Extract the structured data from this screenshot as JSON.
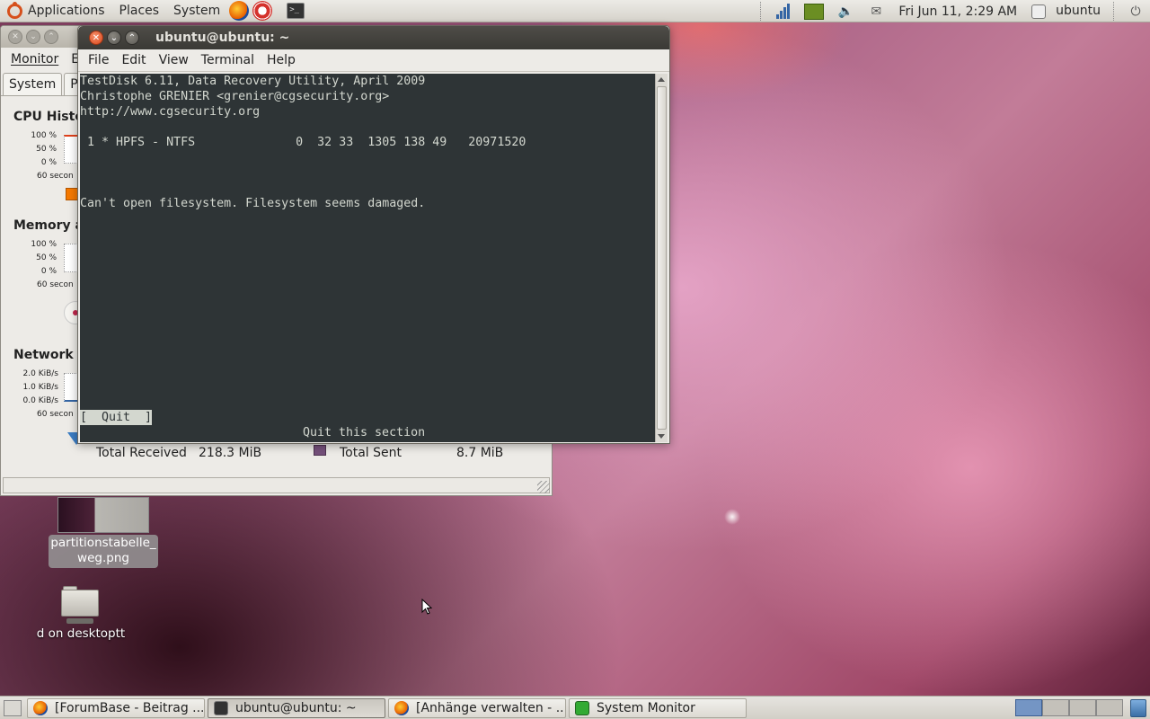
{
  "top_panel": {
    "menus": [
      "Applications",
      "Places",
      "System"
    ],
    "clock": "Fri Jun 11,  2:29 AM",
    "user": "ubuntu"
  },
  "system_monitor": {
    "menus": [
      "Monitor",
      "Ed"
    ],
    "tabs": [
      "System",
      "Pro"
    ],
    "sections": {
      "cpu": "CPU Histo",
      "memory": "Memory a",
      "network": "Network I"
    },
    "cpu_axis": [
      "100 %",
      "50 %",
      "0 %",
      "60 secon"
    ],
    "mem_axis": [
      "100 %",
      "50 %",
      "0 %",
      "60 secon"
    ],
    "net_axis": [
      "2.0 KiB/s",
      "1.0 KiB/s",
      "0.0 KiB/s",
      "60 secon"
    ],
    "total_received_label": "Total Received",
    "total_received_value": "218.3 MiB",
    "total_sent_label": "Total Sent",
    "total_sent_value": "8.7 MiB"
  },
  "terminal": {
    "title": "ubuntu@ubuntu: ~",
    "menus": [
      "File",
      "Edit",
      "View",
      "Terminal",
      "Help"
    ],
    "lines": [
      "TestDisk 6.11, Data Recovery Utility, April 2009",
      "Christophe GRENIER <grenier@cgsecurity.org>",
      "http://www.cgsecurity.org",
      " 1 * HPFS - NTFS              0  32 33  1305 138 49   20971520",
      "Can't open filesystem. Filesystem seems damaged."
    ],
    "quit_button": "[  Quit  ]",
    "footer": "Quit this section"
  },
  "desktop_icons": [
    {
      "label": "partitionstabelle_\nweg.png"
    },
    {
      "label": "d on desktoptt"
    }
  ],
  "taskbar": [
    {
      "label": "[ForumBase - Beitrag ...",
      "icon": "firefox-icon"
    },
    {
      "label": "ubuntu@ubuntu: ~",
      "icon": "terminal-icon"
    },
    {
      "label": "[Anhänge verwalten - ...",
      "icon": "firefox-icon"
    },
    {
      "label": "System Monitor",
      "icon": "system-monitor-icon"
    }
  ],
  "colors": {
    "terminal_bg": "#2e3436",
    "terminal_fg": "#d3d7cf",
    "close_button": "#d9471b",
    "panel": "#dcd9d2"
  }
}
